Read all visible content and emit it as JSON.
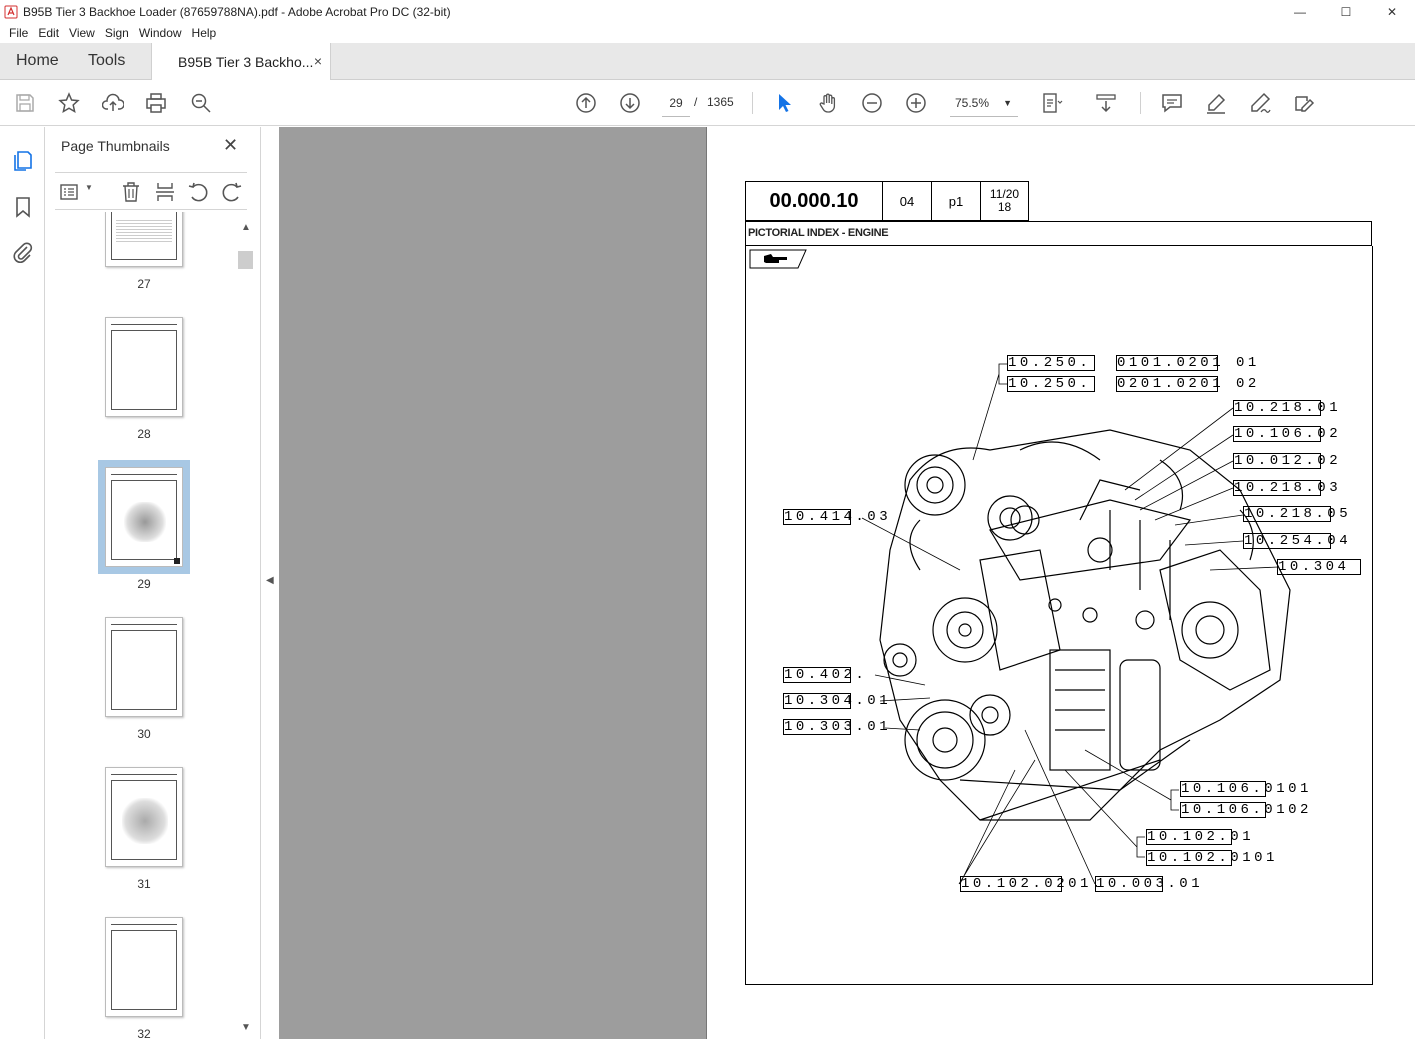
{
  "window": {
    "title": "B95B Tier 3 Backhoe Loader (87659788NA).pdf - Adobe Acrobat Pro DC (32-bit)",
    "minimize": "—",
    "maximize": "☐",
    "close": "✕"
  },
  "menu": [
    "File",
    "Edit",
    "View",
    "Sign",
    "Window",
    "Help"
  ],
  "tabs": {
    "home": "Home",
    "tools": "Tools",
    "document": "B95B Tier 3 Backho...",
    "document_close": "×"
  },
  "toolbar": {
    "current_page": "29",
    "page_separator": "/",
    "total_pages": "1365",
    "zoom": "75.5%",
    "icons": [
      "save-icon",
      "star-icon",
      "upload-icon",
      "print-icon",
      "zoom-search-icon",
      "page-up-icon",
      "page-down-icon",
      "select-arrow-icon",
      "hand-icon",
      "zoom-out-icon",
      "zoom-in-icon",
      "fit-page-icon",
      "scroll-mode-icon",
      "comment-icon",
      "highlight-icon",
      "sign-icon",
      "fill-sign-icon"
    ]
  },
  "sidebar": {
    "title": "Page Thumbnails",
    "close": "✕",
    "thumbnails": [
      {
        "label": "27"
      },
      {
        "label": "28"
      },
      {
        "label": "29",
        "selected": true
      },
      {
        "label": "30"
      },
      {
        "label": "31"
      },
      {
        "label": "32"
      }
    ]
  },
  "document": {
    "header": {
      "code": "00.000.10",
      "revision": "04",
      "page": "p1",
      "date": "11/2018"
    },
    "section_title": "PICTORIAL INDEX - ENGINE",
    "references": {
      "r1a": "10.250.",
      "r1b": "0101.0201 01",
      "r2a": "10.250.",
      "r2b": "0201.0201 02",
      "r3": "10.218.01",
      "r4": "10.106.02",
      "r5": "10.012.02",
      "r6": "10.218.03",
      "r7": "10.218.05",
      "r8": "10.254.04",
      "r9": "10.304",
      "r10": "10.414.03",
      "r11": "10.402.",
      "r12": "10.304.01",
      "r13": "10.303.01",
      "r14": "10.106.0101",
      "r15": "10.106.0102",
      "r16": "10.102.01",
      "r17": "10.102.0101",
      "r18": "10.102.0201.",
      "r19": "10.003.01"
    }
  },
  "colors": {
    "doc_background": "#9d9d9d",
    "selection": "#a8c8e4",
    "pdf_icon": "#d32f2f",
    "select_tool": "#1473e6"
  }
}
